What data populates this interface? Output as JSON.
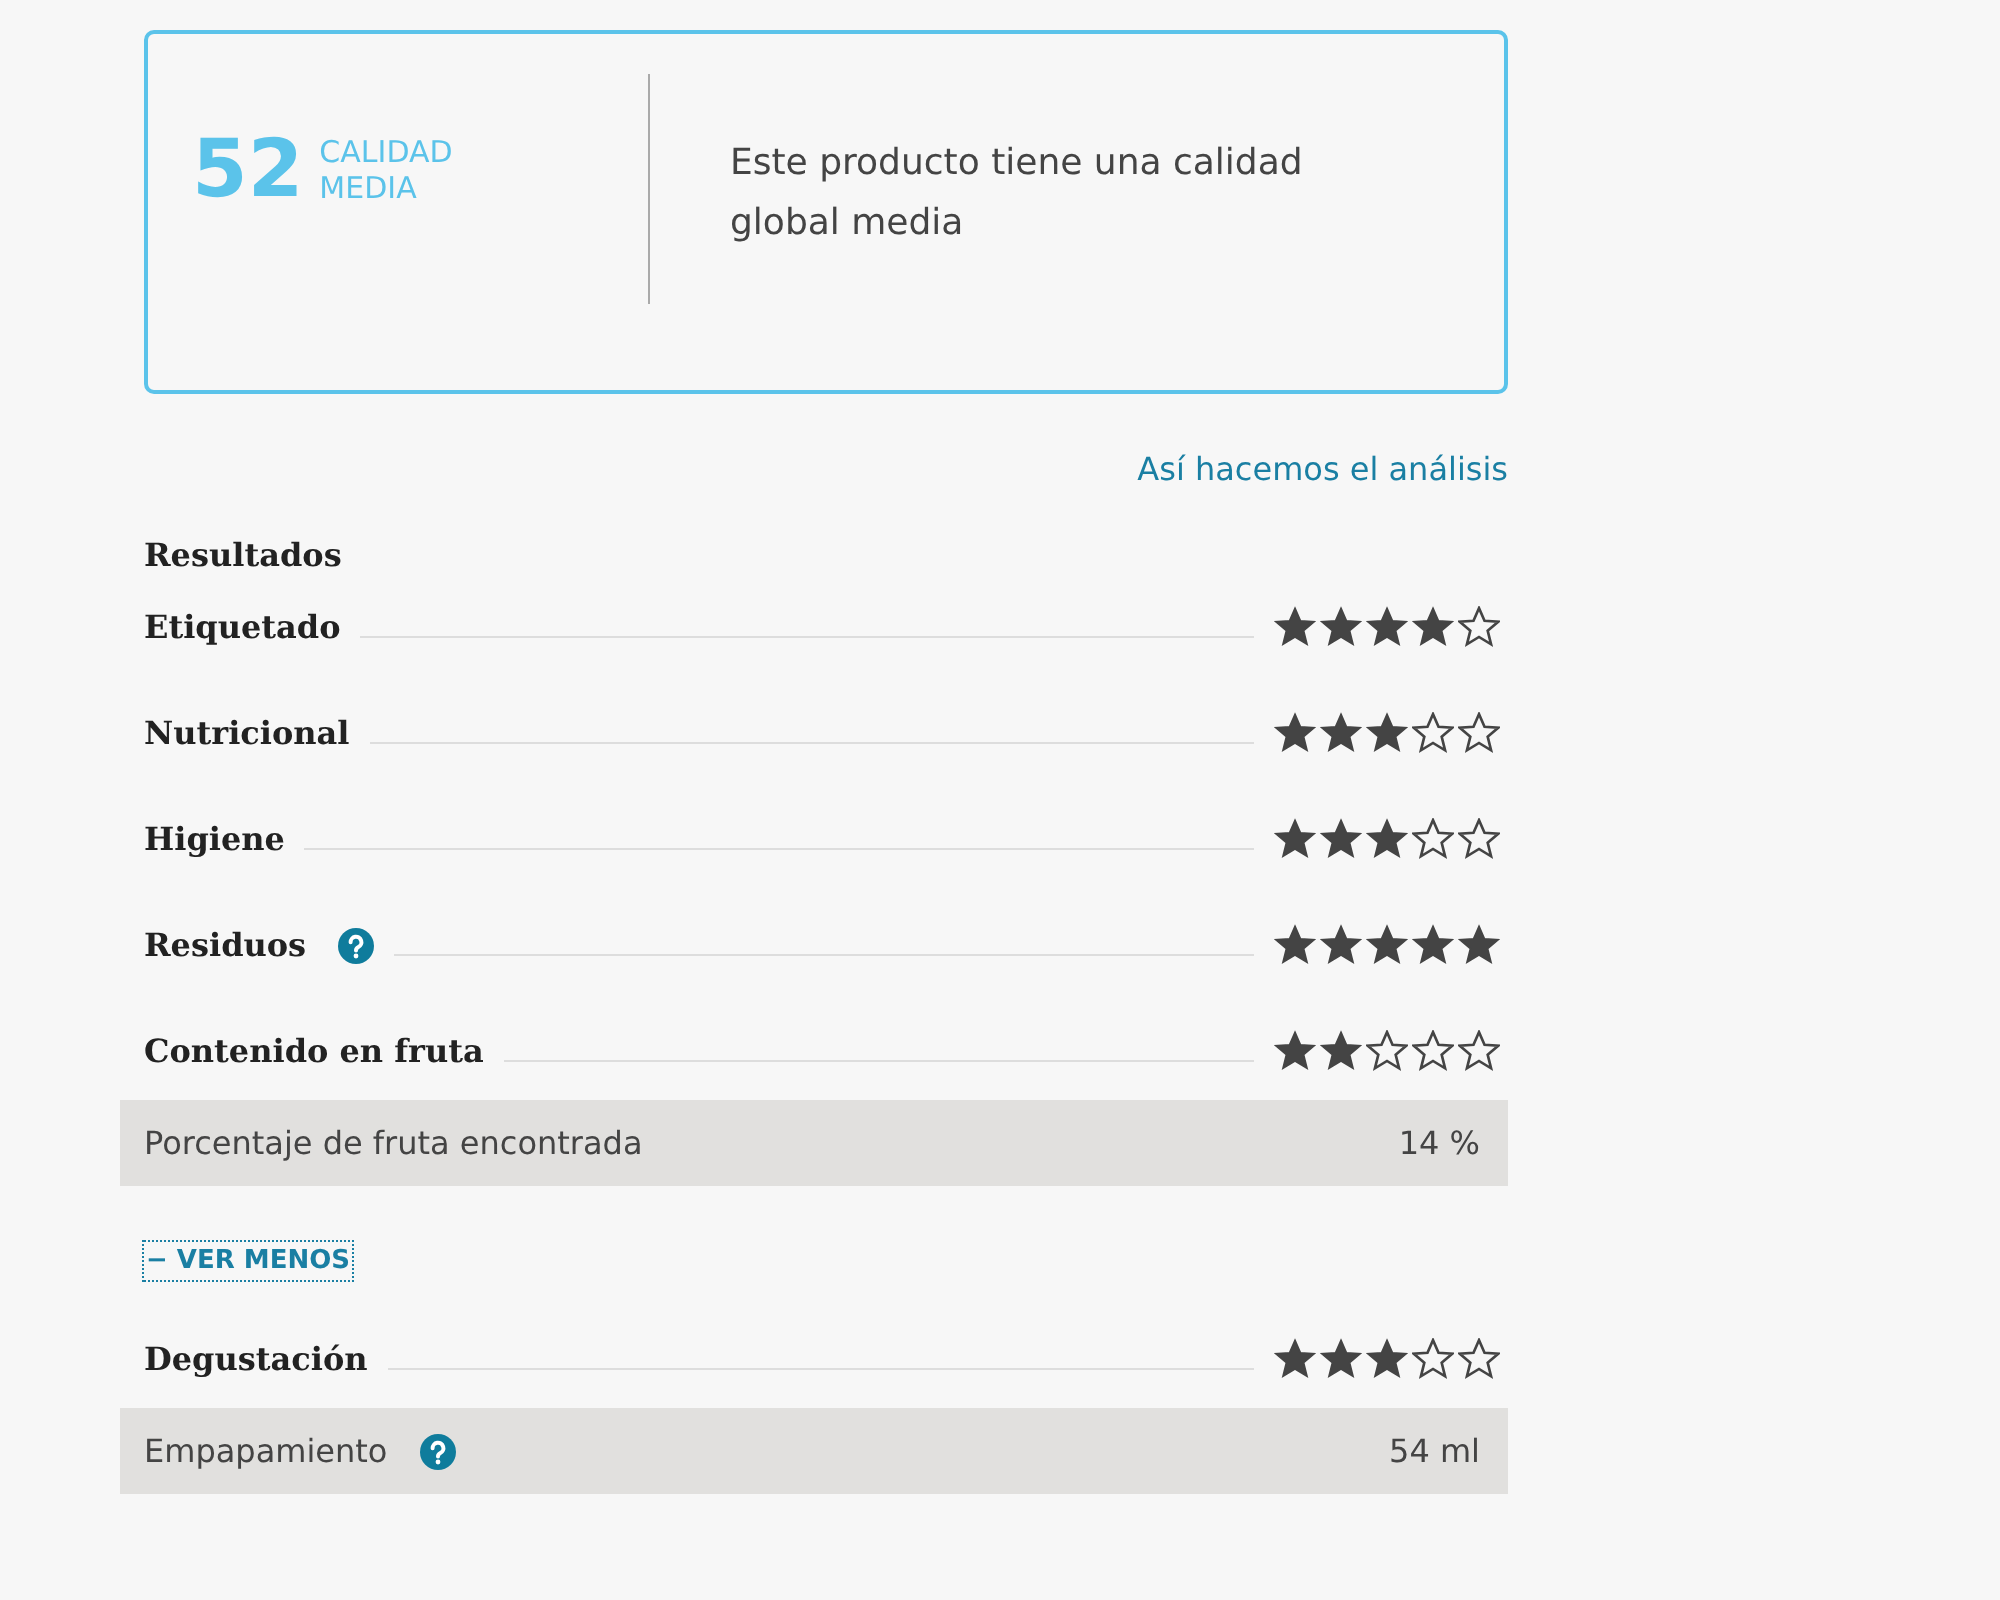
{
  "summary": {
    "score": "52",
    "grade": "CALIDAD MEDIA",
    "description": "Este producto tiene una calidad global media"
  },
  "method_link": "Así hacemos el análisis",
  "results": {
    "title": "Resultados",
    "rows": [
      {
        "kind": "rating",
        "label": "Etiquetado",
        "help": false,
        "stars": 4
      },
      {
        "kind": "rating",
        "label": "Nutricional",
        "help": false,
        "stars": 3
      },
      {
        "kind": "rating",
        "label": "Higiene",
        "help": false,
        "stars": 3
      },
      {
        "kind": "rating",
        "label": "Residuos",
        "help": true,
        "stars": 5
      },
      {
        "kind": "rating",
        "label": "Contenido en fruta",
        "help": false,
        "stars": 2
      },
      {
        "kind": "detail",
        "label": "Porcentaje de fruta encontrada",
        "help": false,
        "value": "14 %"
      },
      {
        "kind": "toggle",
        "label": "− VER MENOS"
      },
      {
        "kind": "rating",
        "label": "Degustación",
        "help": false,
        "stars": 3
      },
      {
        "kind": "detail",
        "label": "Empapamiento",
        "help": true,
        "value": "54 ml"
      }
    ]
  }
}
